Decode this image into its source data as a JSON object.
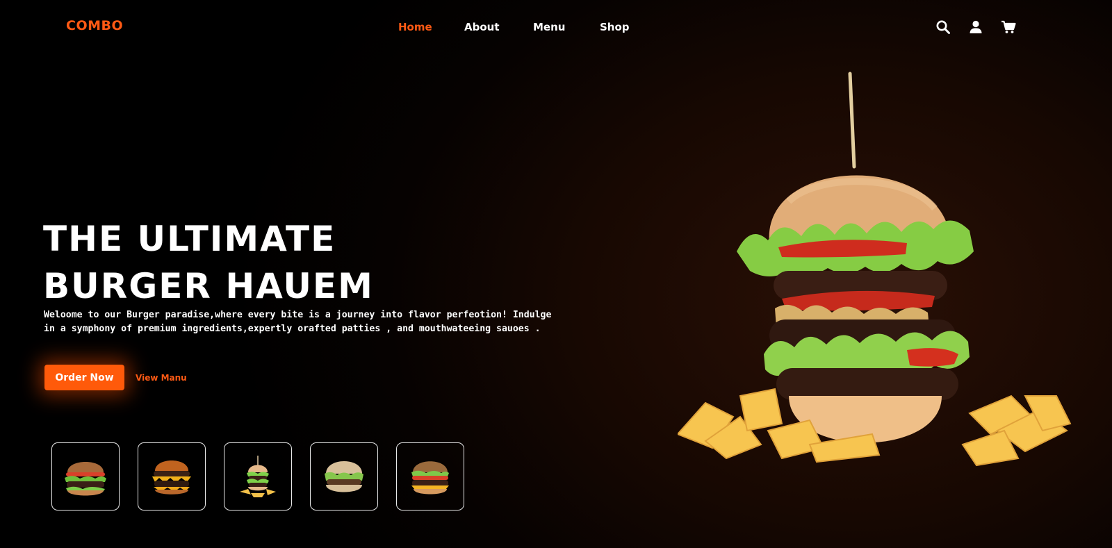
{
  "nav": {
    "logo": "COMBO",
    "links": [
      {
        "label": "Home",
        "active": true
      },
      {
        "label": "About",
        "active": false
      },
      {
        "label": "Menu",
        "active": false
      },
      {
        "label": "Shop",
        "active": false
      }
    ],
    "icons": [
      "search-icon",
      "user-icon",
      "cart-icon"
    ]
  },
  "hero": {
    "title_line1": "THE ULTIMATE",
    "title_line2": "BURGER HAUEM",
    "text": "Weloome to our Burger paradise,where every bite is a journey into flavor perfeotion! Indulge in a symphony of premium ingredients,expertly orafted patties , and mouthwateeing sauoes .",
    "order_button": "Order Now",
    "view_menu_link": "View Manu"
  },
  "thumbnails": [
    "burger-thumbnail-1",
    "burger-thumbnail-2",
    "burger-thumbnail-3",
    "burger-thumbnail-4",
    "burger-thumbnail-5"
  ],
  "colors": {
    "accent": "#ff5a14",
    "background": "#000000",
    "text": "#ffffff"
  }
}
